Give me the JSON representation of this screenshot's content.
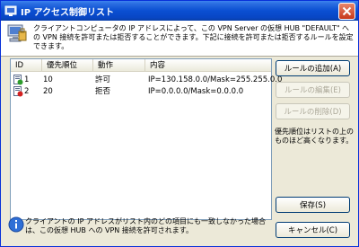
{
  "window": {
    "title": "IP アクセス制御リスト"
  },
  "header": {
    "text": "クライアントコンピュータの IP アドレスによって、この VPN Server の仮想 HUB \"DEFAULT\" への VPN 接続を許可または拒否することができます。下記に接続を許可または拒否するルールを設定できます。"
  },
  "list": {
    "columns": [
      "ID",
      "優先順位",
      "動作",
      "内容"
    ],
    "rows": [
      {
        "id": "1",
        "priority": "10",
        "action": "許可",
        "content": "IP=130.158.0.0/Mask=255.255.0.0",
        "icon": "allow-rule-icon"
      },
      {
        "id": "2",
        "priority": "20",
        "action": "拒否",
        "content": "IP=0.0.0.0/Mask=0.0.0.0",
        "icon": "deny-rule-icon"
      }
    ]
  },
  "buttons": {
    "add": "ルールの追加(A)",
    "edit": "ルールの編集(E)",
    "delete": "ルールの削除(D)",
    "save": "保存(S)",
    "cancel": "キャンセル(C)"
  },
  "note": "優先順位はリストの上のものほど高くなります。",
  "footer": {
    "text": "クライアントの IP アドレスがリスト内のどの項目にも一致しなかった場合は、この仮想 HUB への VPN 接続を許可されます。"
  },
  "colors": {
    "titlebar": "#0a4fd2",
    "close": "#c7381a",
    "allow": "#2e9c2e",
    "deny": "#d22020"
  }
}
